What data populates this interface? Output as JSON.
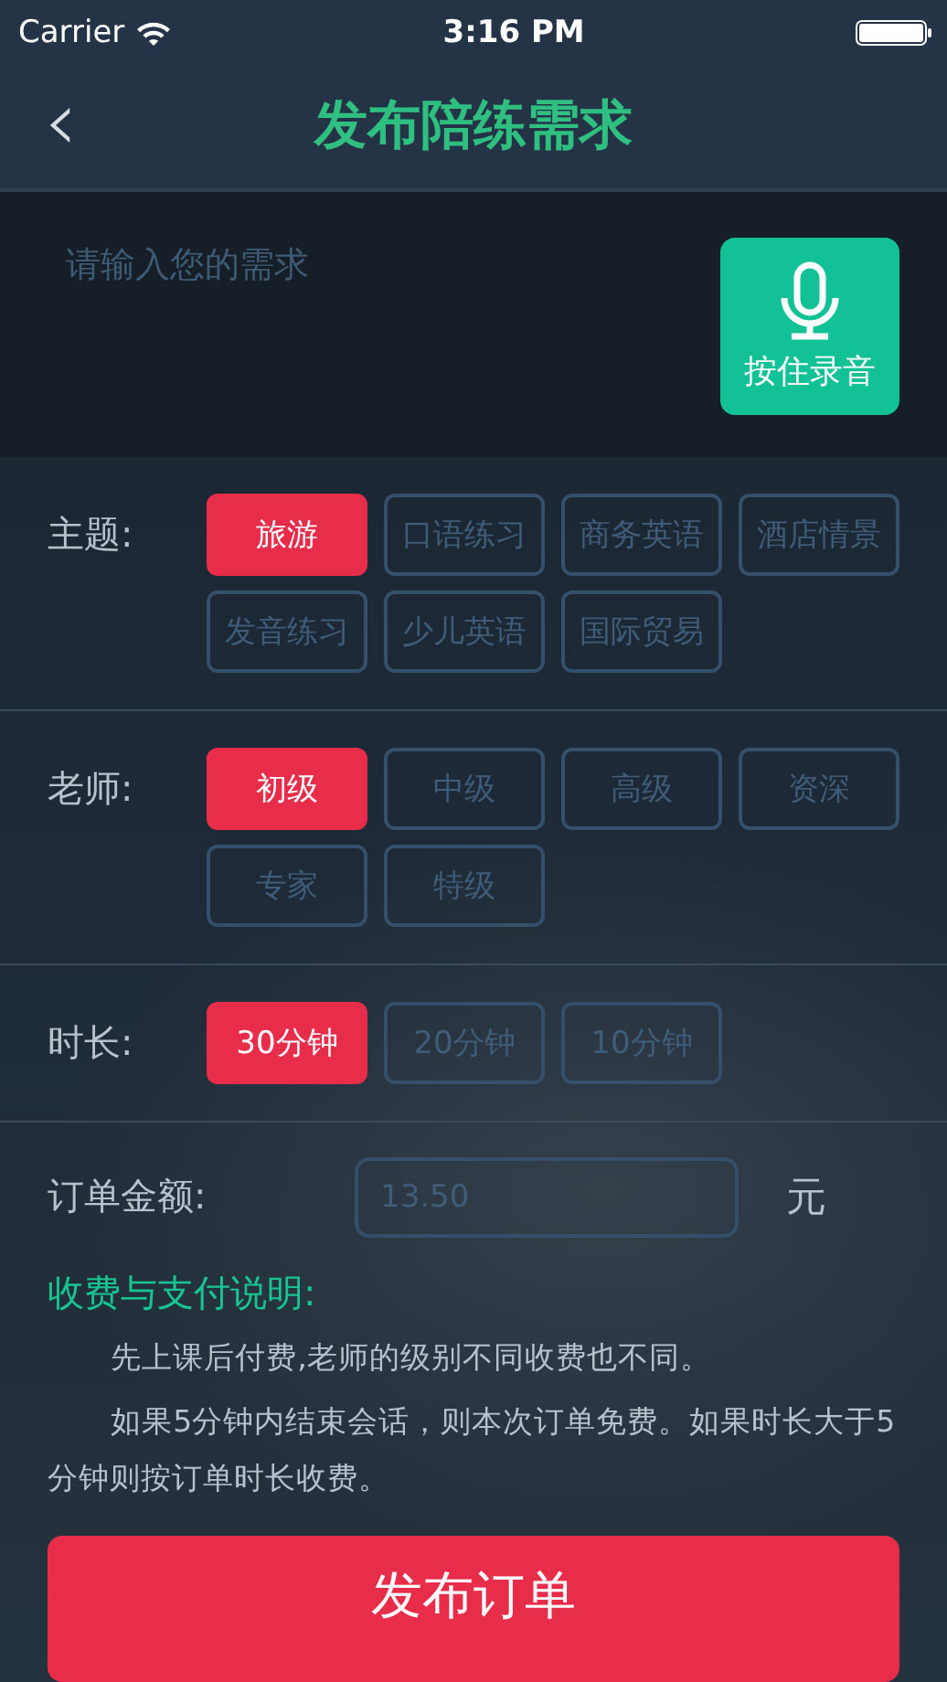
{
  "status_bar": {
    "carrier": "Carrier",
    "time": "3:16 PM"
  },
  "nav": {
    "back": "‹",
    "title": "发布陪练需求"
  },
  "request": {
    "placeholder": "请输入您的需求",
    "record_button": "按住录音"
  },
  "groups": [
    {
      "label": "主题:",
      "options": [
        {
          "label": "旅游",
          "selected": true
        },
        {
          "label": "口语练习",
          "selected": false
        },
        {
          "label": "商务英语",
          "selected": false
        },
        {
          "label": "酒店情景",
          "selected": false
        },
        {
          "label": "发音练习",
          "selected": false
        },
        {
          "label": "少儿英语",
          "selected": false
        },
        {
          "label": "国际贸易",
          "selected": false
        }
      ]
    },
    {
      "label": "老师:",
      "options": [
        {
          "label": "初级",
          "selected": true
        },
        {
          "label": "中级",
          "selected": false
        },
        {
          "label": "高级",
          "selected": false
        },
        {
          "label": "资深",
          "selected": false
        },
        {
          "label": "专家",
          "selected": false
        },
        {
          "label": "特级",
          "selected": false
        }
      ]
    },
    {
      "label": "时长:",
      "options": [
        {
          "label": "30分钟",
          "selected": true
        },
        {
          "label": "20分钟",
          "selected": false
        },
        {
          "label": "10分钟",
          "selected": false
        }
      ]
    }
  ],
  "amount": {
    "label": "订单金额:",
    "placeholder": "13.50",
    "unit": "元"
  },
  "notes": {
    "title": "收费与支付说明:",
    "paragraphs": [
      "先上课后付费,老师的级别不同收费也不同。",
      "如果5分钟内结束会话，则本次订单免费。如果时长大于5分钟则按订单时长收费。"
    ]
  },
  "submit": "发布订单"
}
